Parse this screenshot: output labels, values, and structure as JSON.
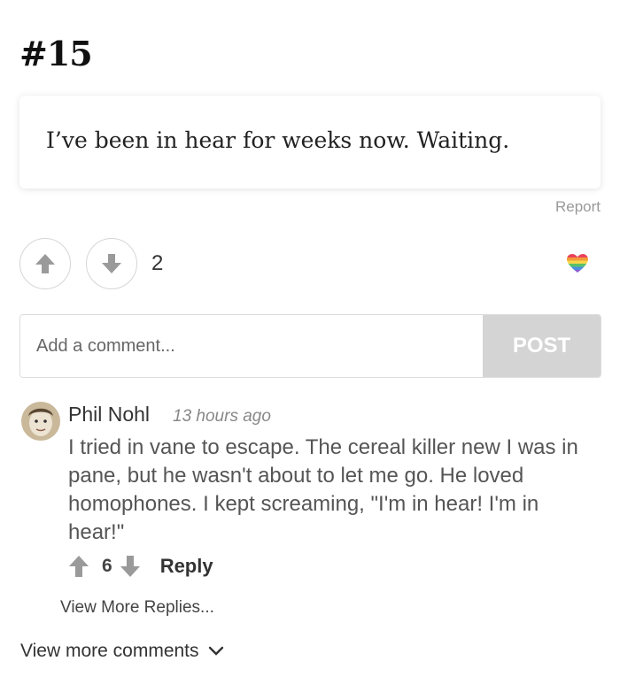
{
  "post": {
    "rank": "#15",
    "text": "I’ve been in hear for weeks now. Waiting.",
    "report_label": "Report",
    "vote_count": "2",
    "upvote_icon": "arrow-up-icon",
    "downvote_icon": "arrow-down-icon",
    "badge_icon": "rainbow-heart-icon"
  },
  "comment_form": {
    "placeholder": "Add a comment...",
    "post_label": "POST"
  },
  "comments": [
    {
      "author": "Phil Nohl",
      "time": "13 hours ago",
      "text": "I tried in vane to escape. The cereal killer new I was in pane, but he wasn't about to let me go. He loved homophones. I kept screaming, \"I'm in hear! I'm in hear!\"",
      "votes": "6",
      "reply_label": "Reply",
      "view_replies_label": "View More Replies..."
    }
  ],
  "footer": {
    "view_more_label": "View more comments",
    "chevron_icon": "chevron-down-icon"
  },
  "colors": {
    "arrow_gray": "#9a9a9a",
    "post_button_bg": "#d4d4d4",
    "heart_stripes": [
      "#e8425a",
      "#f29b38",
      "#f6d64a",
      "#5cc06a",
      "#4a8fe0",
      "#8a5bd0"
    ]
  }
}
